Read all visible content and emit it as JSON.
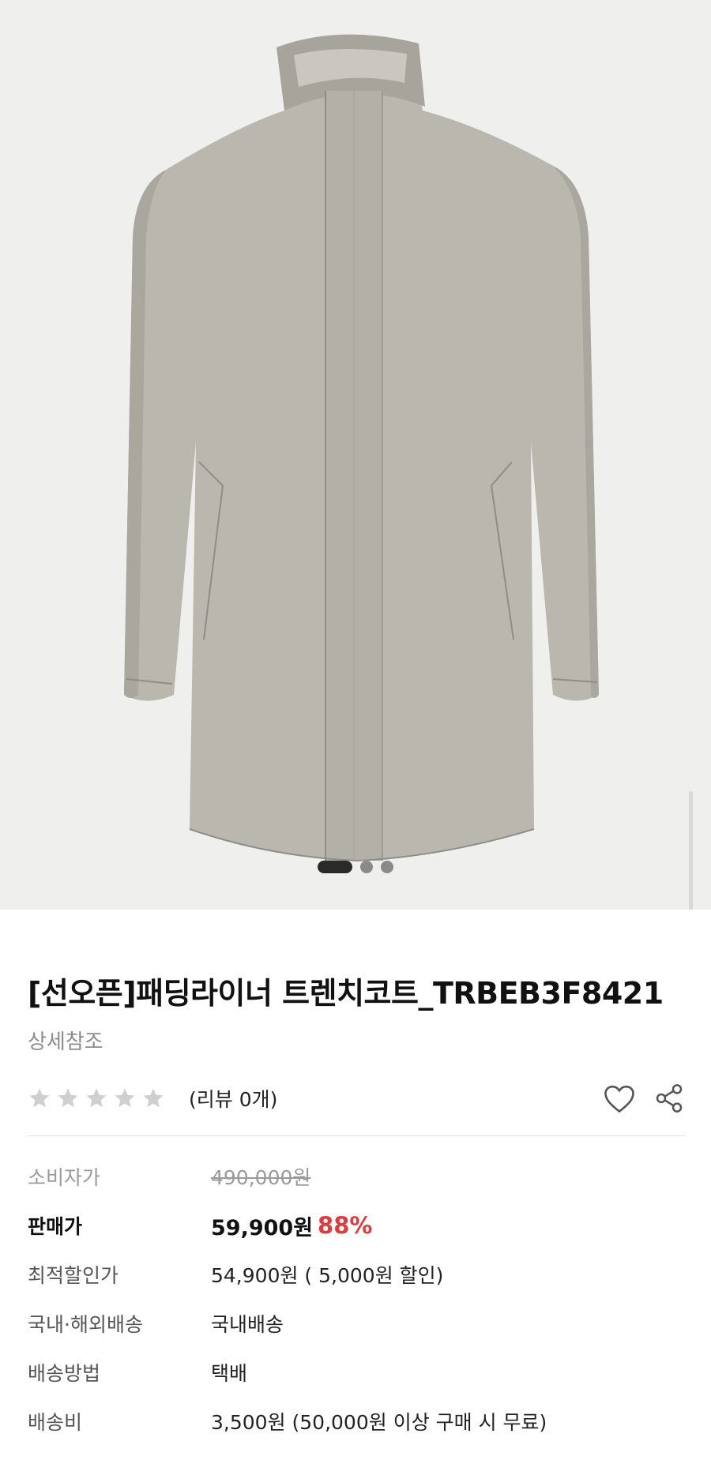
{
  "product": {
    "title": "[선오픈]패딩라이너 트렌치코트_TRBEB3F8421",
    "brand": "상세참조",
    "review_label": "(리뷰 0개)",
    "rating_stars": 0,
    "rating_max": 5
  },
  "gallery": {
    "total": 3,
    "current": 1
  },
  "prices": [
    {
      "label": "소비자가",
      "value": "490,000원",
      "percent": ""
    },
    {
      "label": "판매가",
      "value": "59,900원",
      "percent": "88%"
    },
    {
      "label": "최적할인가",
      "value": "54,900원 ( 5,000원 할인)",
      "percent": ""
    },
    {
      "label": "국내·해외배송",
      "value": "국내배송",
      "percent": ""
    },
    {
      "label": "배송방법",
      "value": "택배",
      "percent": ""
    },
    {
      "label": "배송비",
      "value": "3,500원 (50,000원 이상 구매 시 무료)",
      "percent": ""
    }
  ],
  "icons": {
    "wishlist": "heart-icon",
    "share": "share-icon",
    "star": "star-icon"
  },
  "colors": {
    "discount": "#e23b3b",
    "coat": "#b9b7ae",
    "hero_bg": "#efefee"
  }
}
